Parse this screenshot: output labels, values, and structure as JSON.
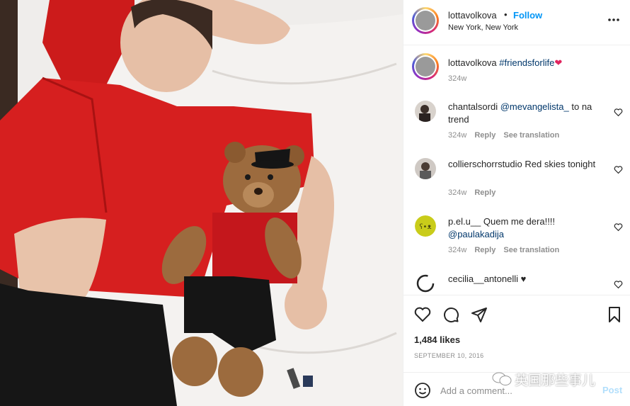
{
  "post": {
    "username": "lottavolkova",
    "dot": "•",
    "follow_label": "Follow",
    "location": "New York, New York"
  },
  "caption": {
    "username": "lottavolkova",
    "hashtag": "#friendsforlife",
    "emoji": "❤",
    "time": "324w"
  },
  "comments": [
    {
      "username": "chantalsordi",
      "mention": "@mevangelista_",
      "text": " to na trend",
      "time": "324w",
      "reply": "Reply",
      "translate": "See translation"
    },
    {
      "username": "collierschorrstudio",
      "mention": "",
      "text": " Red skies tonight",
      "time": "324w",
      "reply": "Reply",
      "translate": ""
    },
    {
      "username": "p.el.u__",
      "mention": "",
      "text": " Quem me dera!!!! ",
      "mention2": "@paulakadija",
      "time": "324w",
      "reply": "Reply",
      "translate": "See translation"
    },
    {
      "username": "cecilia__antonelli",
      "mention": "",
      "text": " ♥",
      "time": "",
      "reply": "",
      "translate": ""
    }
  ],
  "actions": {
    "likes": "1,484 likes",
    "date": "SEPTEMBER 10, 2016"
  },
  "add_comment": {
    "placeholder": "Add a comment...",
    "post_label": "Post"
  },
  "watermark": "英国那些事儿",
  "icons": {
    "more": "more-options-icon",
    "like": "heart-icon",
    "comment": "comment-bubble-icon",
    "share": "paper-plane-icon",
    "save": "bookmark-icon",
    "emoji": "smiley-icon"
  },
  "colors": {
    "link_blue": "#0095f6",
    "mention": "#00376b",
    "muted": "#8e8e8e",
    "text": "#262626",
    "shirt_red": "#d61f1f"
  }
}
